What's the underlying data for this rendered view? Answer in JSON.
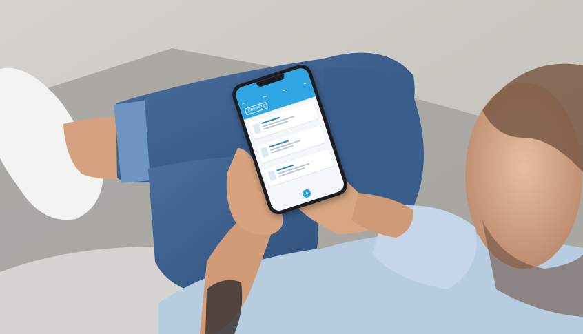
{
  "scene": {
    "description_free": true,
    "colors": {
      "floor": "#c9c6c1",
      "rug": "#9d9c98",
      "sofa": "#d7d6d2",
      "jeans": "#3b5f8e",
      "shirt": "#b9cde0",
      "skin": "#d7a57f",
      "shoe": "#f2f2f0",
      "phone": "#1b1d22",
      "app_blue": "#2fa6e3"
    }
  },
  "phone_screen": {
    "app_title": "",
    "page_heading": "Übersicht",
    "icons": {
      "fab": "plus-icon",
      "document": "document-icon"
    }
  }
}
